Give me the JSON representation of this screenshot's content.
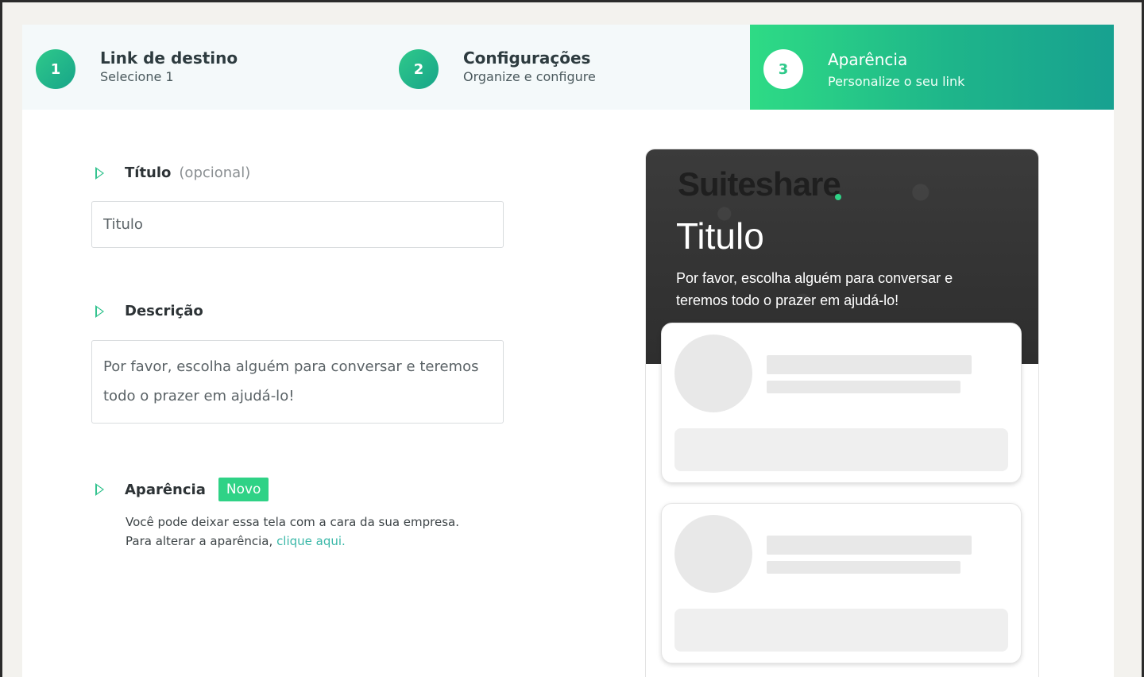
{
  "steps": [
    {
      "number": "1",
      "title": "Link de destino",
      "subtitle": "Selecione 1"
    },
    {
      "number": "2",
      "title": "Configurações",
      "subtitle": "Organize e configure"
    },
    {
      "number": "3",
      "title": "Aparência",
      "subtitle": "Personalize o seu link"
    }
  ],
  "form": {
    "title_label": "Título",
    "title_optional": "(opcional)",
    "title_value": "Titulo",
    "description_label": "Descrição",
    "description_value": "Por favor, escolha alguém para conversar e teremos todo o prazer em ajudá-lo!",
    "appearance_label": "Aparência",
    "appearance_badge": "Novo",
    "appearance_help_1": "Você pode deixar essa tela com a cara da sua empresa.",
    "appearance_help_2": "Para alterar a aparência,",
    "appearance_link": "clique aqui."
  },
  "preview": {
    "logo": "Suiteshare",
    "title": "Titulo",
    "description": "Por favor, escolha alguém para conversar e teremos todo o prazer em ajudá-lo!"
  },
  "colors": {
    "accent": "#2fd286",
    "accent_dark": "#17a589",
    "link": "#3ab8a8"
  }
}
